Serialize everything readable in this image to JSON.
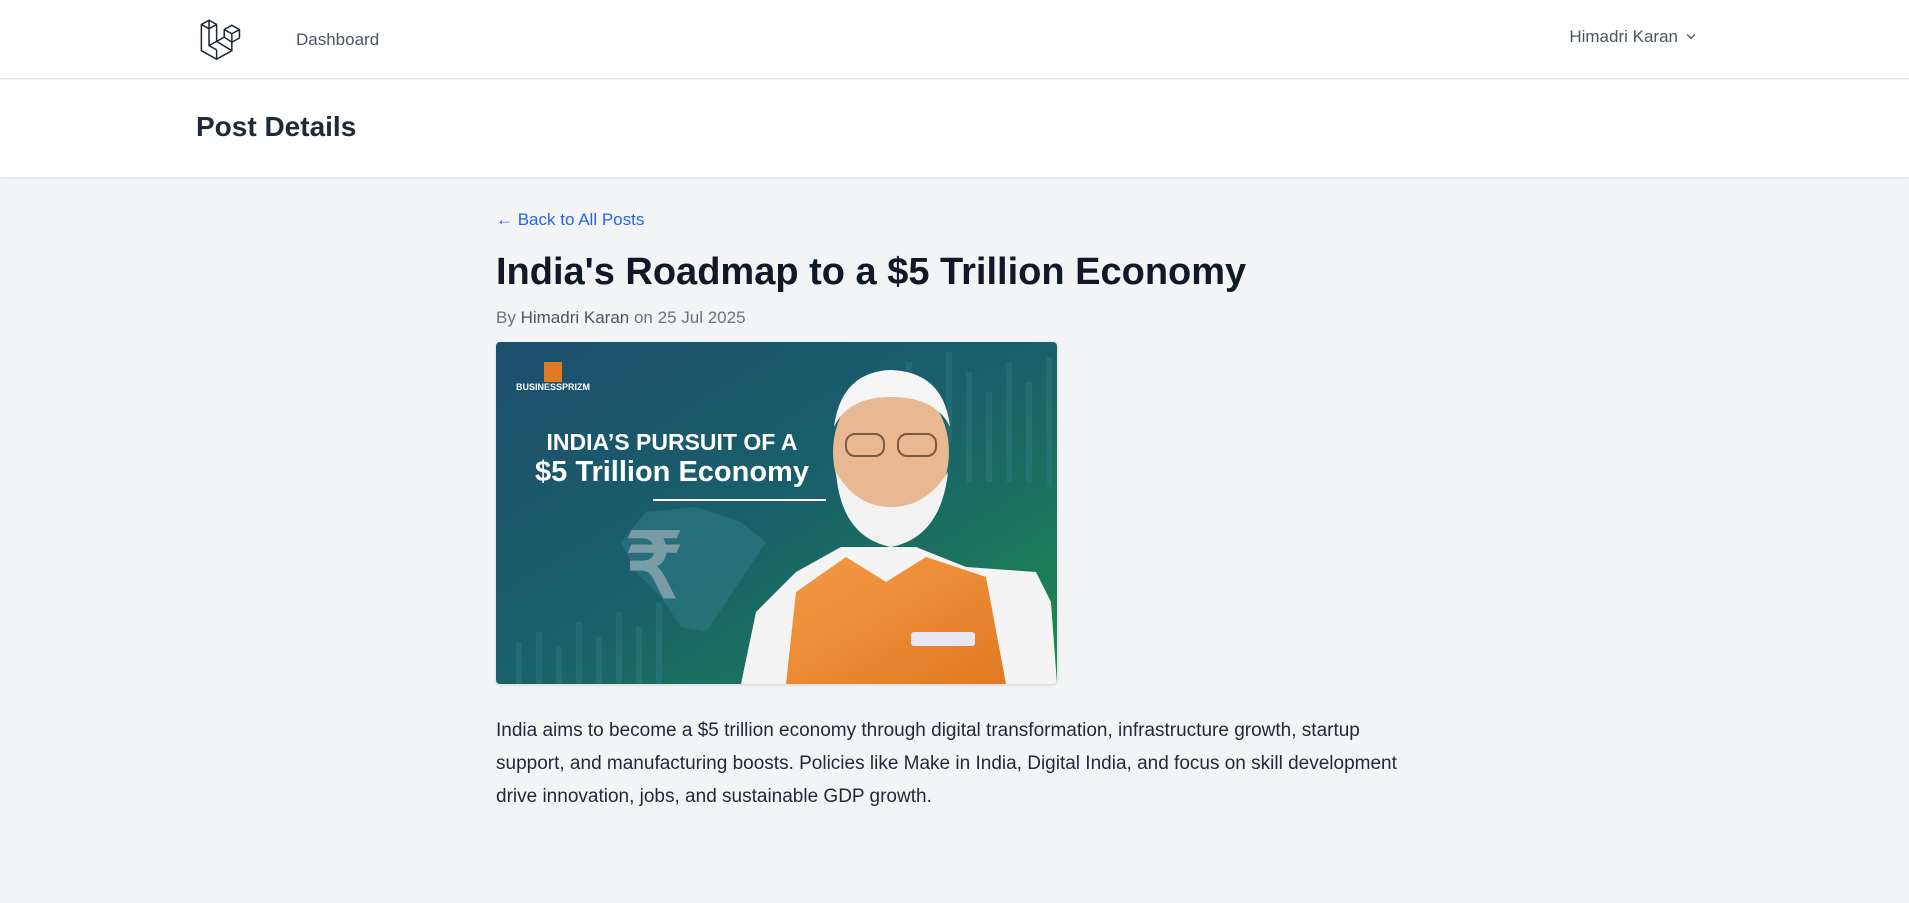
{
  "nav": {
    "dashboard_label": "Dashboard",
    "user_name": "Himadri Karan"
  },
  "header": {
    "title": "Post Details"
  },
  "post": {
    "back_label": "← Back to All Posts",
    "title": "India's Roadmap to a $5 Trillion Economy",
    "meta_prefix": "By",
    "author": "Himadri Karan",
    "meta_on": "on",
    "date": "25 Jul 2025",
    "image": {
      "brand": "BUSINESSPRIZM",
      "headline_line1": "INDIA’S PURSUIT OF A",
      "headline_line2": "$5 Trillion Economy",
      "currency_symbol": "₹"
    },
    "body": "India aims to become a $5 trillion economy through digital transformation, infrastructure growth, startup support, and manufacturing boosts. Policies like Make in India, Digital India, and focus on skill development drive innovation, jobs, and sustainable GDP growth."
  },
  "colors": {
    "link": "#2563eb",
    "nav_text": "#4b5563",
    "page_bg": "#f3f4f6"
  },
  "icons": [
    "laravel-logo-icon",
    "chevron-down-icon"
  ]
}
